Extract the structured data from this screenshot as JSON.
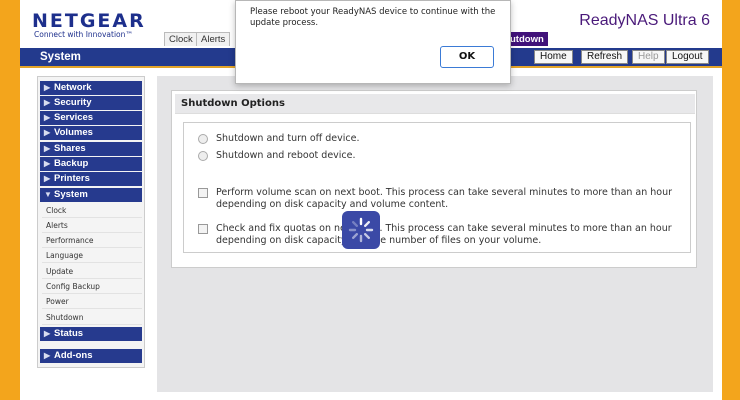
{
  "header": {
    "logo": "NETGEAR",
    "tagline": "Connect with Innovation™",
    "product": "ReadyNAS Ultra 6"
  },
  "tabs": {
    "clock": "Clock",
    "alerts": "Alerts",
    "shutdown": "utdown"
  },
  "sysbar": {
    "title": "System",
    "buttons": {
      "home": "Home",
      "refresh": "Refresh",
      "help": "Help",
      "logout": "Logout"
    }
  },
  "sidebar": {
    "items": [
      {
        "label": "Network"
      },
      {
        "label": "Security"
      },
      {
        "label": "Services"
      },
      {
        "label": "Volumes"
      },
      {
        "label": "Shares"
      },
      {
        "label": "Backup"
      },
      {
        "label": "Printers"
      },
      {
        "label": "System"
      }
    ],
    "subitems": [
      {
        "label": "Clock"
      },
      {
        "label": "Alerts"
      },
      {
        "label": "Performance"
      },
      {
        "label": "Language"
      },
      {
        "label": "Update"
      },
      {
        "label": "Config Backup"
      },
      {
        "label": "Power"
      },
      {
        "label": "Shutdown"
      }
    ],
    "status": "Status",
    "addons": "Add-ons"
  },
  "panel": {
    "title": "Shutdown Options",
    "options": {
      "off": "Shutdown and turn off device.",
      "reboot": "Shutdown and reboot device.",
      "volscan": "Perform volume scan on next boot. This process can take several minutes to more than an hour depending on disk capacity and volume content.",
      "quota": "Check and fix quotas on next boot. This process can take several minutes to more than an hour depending on disk capacity and the number of files on your volume."
    }
  },
  "dialog": {
    "message": "Please reboot your ReadyNAS device to continue with the update process.",
    "ok": "OK"
  },
  "colors": {
    "brand": "#1d2f8c",
    "nav": "#263a8e",
    "accent": "#41127a",
    "frame": "#f3a51c"
  }
}
